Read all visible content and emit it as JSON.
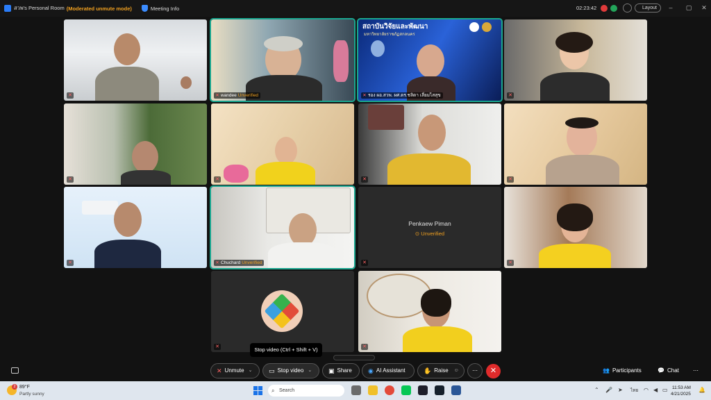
{
  "titlebar": {
    "room": "สวพ's Personal Room",
    "mode": "(Moderated unmute mode)",
    "meeting_info": "Meeting Info",
    "timer": "02:23:42",
    "layout": "Layout"
  },
  "tiles": {
    "t2_name": "wandee",
    "t3_name": "รอง ผอ.สวพ. ผศ.ดร.ชลิดา เลี่ยมไสสุข",
    "t10_name": "Chuchard",
    "t11_name": "Penkaew Piman",
    "unverified": "Unverified"
  },
  "banner": {
    "line1": "สถาบันวิจัยและพัฒนา",
    "line2": "มหาวิทยาลัยราชภัฏสกลนคร"
  },
  "tooltip": "Stop video (Ctrl + Shift + V)",
  "toolbar": {
    "unmute": "Unmute",
    "stop_video": "Stop video",
    "share": "Share",
    "ai_assistant": "AI Assistant",
    "raise": "Raise",
    "participants": "Participants",
    "chat": "Chat"
  },
  "taskbar": {
    "temp": "89°F",
    "condition": "Partly sunny",
    "search": "Search",
    "lang": "ไทย",
    "time": "11:53 AM",
    "date": "4/21/2025",
    "notif_count": "2"
  },
  "colors": {
    "accent_teal": "#1aa68f",
    "unverified_orange": "#f0a020",
    "leave_red": "#e02b2b"
  }
}
